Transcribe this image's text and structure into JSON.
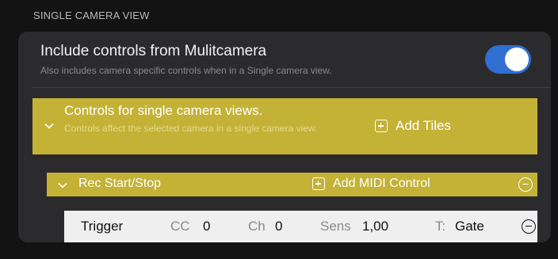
{
  "section": {
    "header": "SINGLE CAMERA VIEW"
  },
  "include": {
    "title": "Include controls from Mulitcamera",
    "subtitle": "Also includes camera specific controls when in a Single camera view.",
    "toggle_on": true
  },
  "controls": {
    "title": "Controls for single camera views.",
    "subtitle": "Controls affect the selected camera in a single camera view.",
    "add_tiles_label": "Add Tiles"
  },
  "rec": {
    "title": "Rec Start/Stop",
    "add_midi_label": "Add MIDI Control"
  },
  "trigger": {
    "label": "Trigger",
    "cc_label": "CC",
    "cc_value": "0",
    "ch_label": "Ch",
    "ch_value": "0",
    "sens_label": "Sens",
    "sens_value": "1,00",
    "type_label": "T:",
    "type_value": "Gate"
  },
  "colors": {
    "accent": "#c4b236",
    "toggle": "#2f6fd1",
    "card": "#2b2b2d",
    "background": "#131313"
  },
  "icons": {
    "collapse": "chevron-down-icon",
    "add": "plus-square-icon",
    "remove": "minus-circle-icon"
  }
}
